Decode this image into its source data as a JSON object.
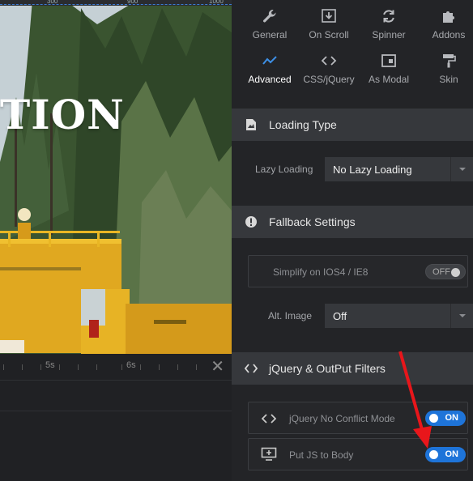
{
  "preview": {
    "ruler_marks": [
      "300",
      "900",
      "1000"
    ],
    "hero_text": "TION"
  },
  "timeline": {
    "ticks": [
      "5s",
      "6s"
    ],
    "close_glyph": "✕"
  },
  "tabs": [
    {
      "label": "General",
      "icon": "wrench-icon"
    },
    {
      "label": "On Scroll",
      "icon": "download-icon"
    },
    {
      "label": "Spinner",
      "icon": "refresh-icon"
    },
    {
      "label": "Addons",
      "icon": "puzzle-icon"
    },
    {
      "label": "Advanced",
      "icon": "chart-line-icon",
      "active": true
    },
    {
      "label": "CSS/jQuery",
      "icon": "code-icon"
    },
    {
      "label": "As Modal",
      "icon": "window-icon"
    },
    {
      "label": "Skin",
      "icon": "paint-roller-icon"
    }
  ],
  "sections": {
    "loading": {
      "title": "Loading Type",
      "field_label": "Lazy Loading",
      "field_value": "No Lazy Loading"
    },
    "fallback": {
      "title": "Fallback Settings",
      "simplify_label": "Simplify on IOS4 / IE8",
      "simplify_state": "OFF",
      "alt_label": "Alt. Image",
      "alt_value": "Off"
    },
    "jquery": {
      "title": "jQuery & OutPut Filters",
      "no_conflict_label": "jQuery No Conflict Mode",
      "no_conflict_state": "ON",
      "put_js_label": "Put JS to Body",
      "put_js_state": "ON"
    }
  },
  "colors": {
    "accent": "#1e74d9",
    "annotation_arrow": "#e8161b",
    "section_bg": "#36383c",
    "panel_bg": "#232427"
  }
}
